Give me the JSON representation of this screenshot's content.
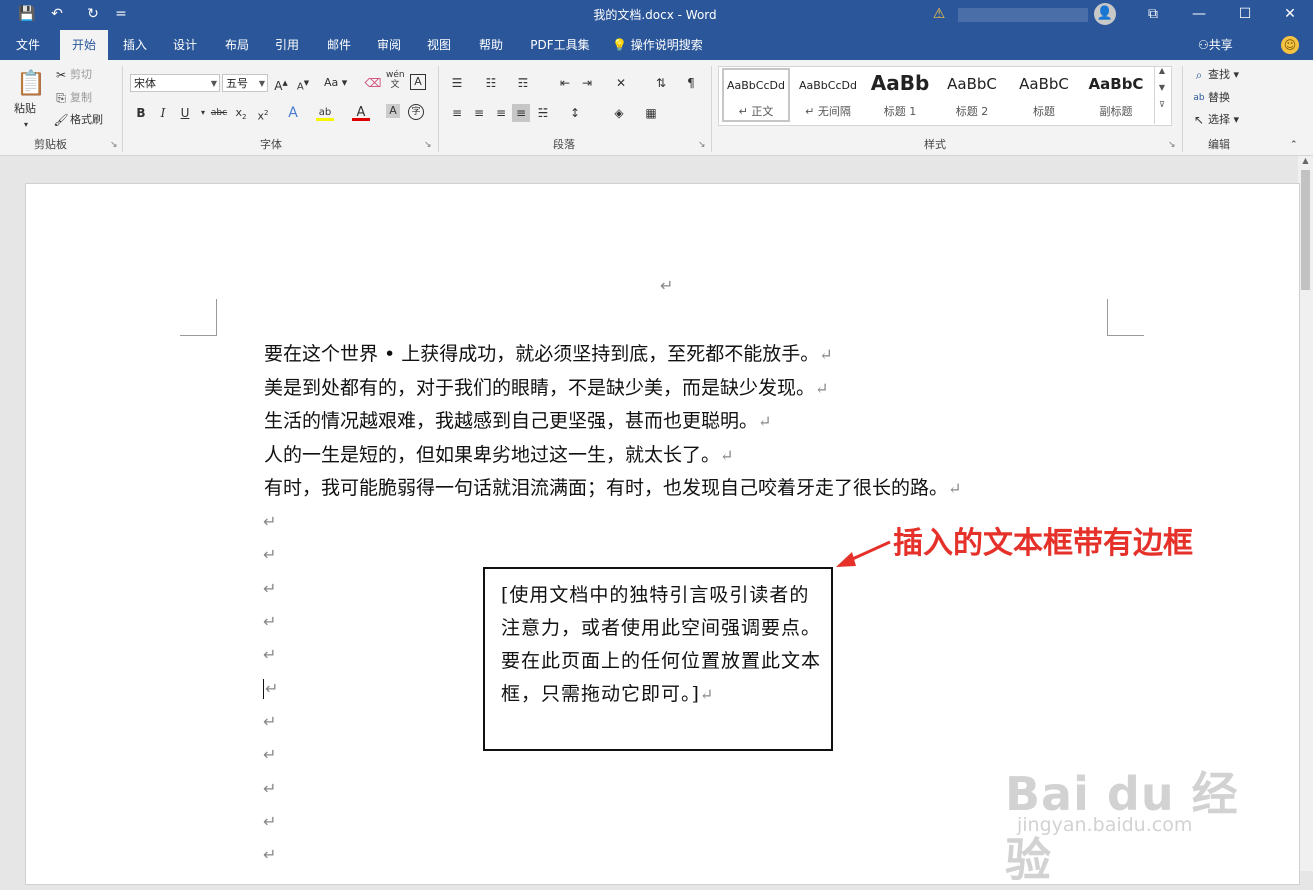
{
  "window": {
    "title": "我的文档.docx  -  Word",
    "controls": {
      "restore_ribbon": "⧉",
      "minimize": "—",
      "maximize": "☐",
      "close": "✕"
    }
  },
  "quick_access": {
    "save": "💾",
    "undo": "↶",
    "redo": "↻",
    "customize": "="
  },
  "tabs": [
    "文件",
    "开始",
    "插入",
    "设计",
    "布局",
    "引用",
    "邮件",
    "审阅",
    "视图",
    "帮助",
    "PDF工具集"
  ],
  "active_tab": "开始",
  "tell_me": "操作说明搜索",
  "share": "共享",
  "ribbon": {
    "clipboard": {
      "label": "剪贴板",
      "paste": "粘贴",
      "cut": "剪切",
      "copy": "复制",
      "format_painter": "格式刷"
    },
    "font": {
      "label": "字体",
      "font_name": "宋体",
      "font_size": "五号",
      "case": "Aa",
      "phonetic": "wén"
    },
    "paragraph": {
      "label": "段落"
    },
    "styles": {
      "label": "样式",
      "items": [
        {
          "sample": "AaBbCcDd",
          "name": "↵ 正文"
        },
        {
          "sample": "AaBbCcDd",
          "name": "↵ 无间隔"
        },
        {
          "sample": "AaBb",
          "name": "标题 1"
        },
        {
          "sample": "AaBbC",
          "name": "标题 2"
        },
        {
          "sample": "AaBbC",
          "name": "标题"
        },
        {
          "sample": "AaBbC",
          "name": "副标题"
        }
      ]
    },
    "editing": {
      "label": "编辑",
      "find": "查找",
      "replace": "替换",
      "select": "选择"
    }
  },
  "document": {
    "paragraphs": [
      "要在这个世界 • 上获得成功，就必须坚持到底，至死都不能放手。",
      "美是到处都有的，对于我们的眼睛，不是缺少美，而是缺少发现。",
      "生活的情况越艰难，我越感到自己更坚强，甚而也更聪明。",
      "人的一生是短的，但如果卑劣地过这一生，就太长了。",
      "有时，我可能脆弱得一句话就泪流满面；有时，也发现自己咬着牙走了很长的路。"
    ],
    "paragraph_mark": "↵",
    "textbox_text": "[使用文档中的独特引言吸引读者的注意力，或者使用此空间强调要点。要在此页面上的任何位置放置此文本框，只需拖动它即可。]"
  },
  "annotation": "插入的文本框带有边框",
  "watermark": {
    "brand": "Bai du 经验",
    "url": "jingyan.baidu.com"
  },
  "colors": {
    "accent": "#2b579a",
    "annotation": "#e5312a"
  }
}
